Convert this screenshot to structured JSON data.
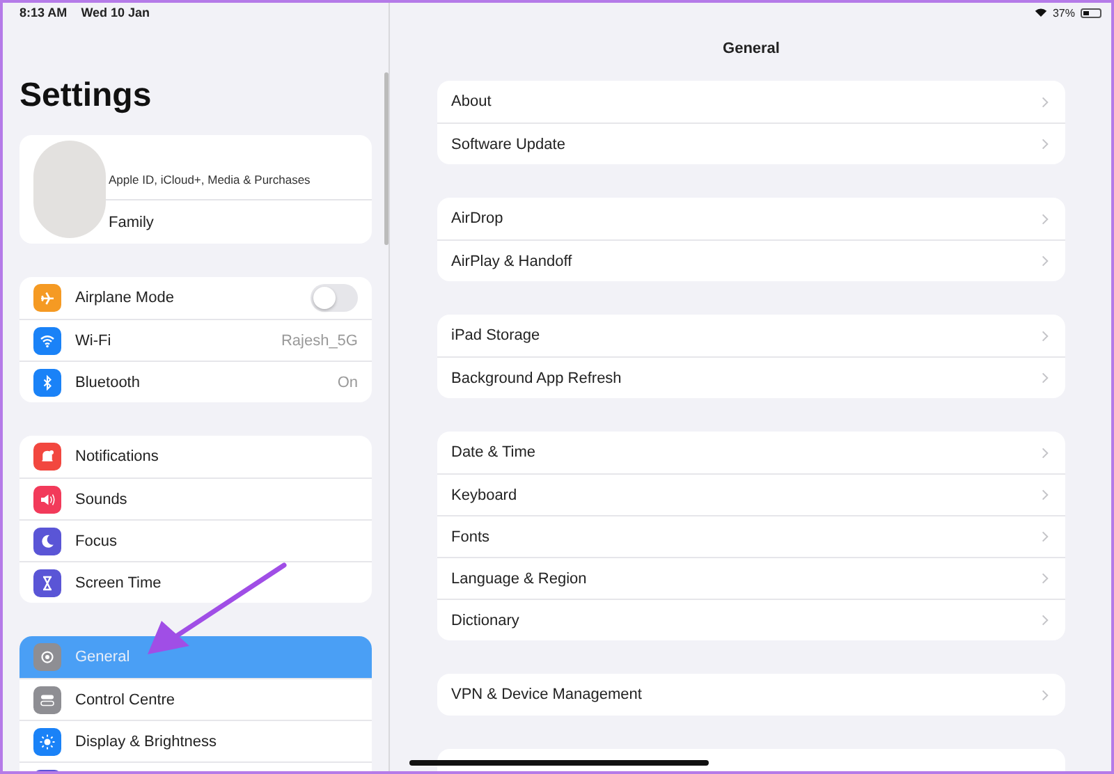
{
  "status_bar": {
    "time": "8:13 AM",
    "date": "Wed 10 Jan",
    "battery": "37%"
  },
  "sidebar": {
    "title": "Settings",
    "account": {
      "subtitle": "Apple ID, iCloud+, Media & Purchases",
      "family": "Family"
    },
    "groups": [
      {
        "items": [
          {
            "label": "Airplane Mode",
            "kind": "toggle",
            "on": false,
            "color": "#f59a23",
            "selected": false
          },
          {
            "label": "Wi-Fi",
            "kind": "value",
            "value": "Rajesh_5G",
            "color": "#1a82f7",
            "selected": false
          },
          {
            "label": "Bluetooth",
            "kind": "value",
            "value": "On",
            "color": "#1a82f7",
            "selected": false
          }
        ]
      },
      {
        "items": [
          {
            "label": "Notifications",
            "kind": "link",
            "color": "#f2473f",
            "selected": false
          },
          {
            "label": "Sounds",
            "kind": "link",
            "color": "#f23a5a",
            "selected": false
          },
          {
            "label": "Focus",
            "kind": "link",
            "color": "#5a55d6",
            "selected": false
          },
          {
            "label": "Screen Time",
            "kind": "link",
            "color": "#5a55d6",
            "selected": false
          }
        ]
      },
      {
        "items": [
          {
            "label": "General",
            "kind": "link",
            "color": "#8e8e93",
            "selected": true
          },
          {
            "label": "Control Centre",
            "kind": "link",
            "color": "#8e8e93",
            "selected": false
          },
          {
            "label": "Display & Brightness",
            "kind": "link",
            "color": "#1a82f7",
            "selected": false
          },
          {
            "kind": "link",
            "color": "#5a55d6",
            "selected": false
          }
        ]
      }
    ]
  },
  "detail": {
    "title": "General",
    "groups": [
      {
        "items": [
          "About",
          "Software Update"
        ]
      },
      {
        "items": [
          "AirDrop",
          "AirPlay & Handoff"
        ]
      },
      {
        "items": [
          "iPad Storage",
          "Background App Refresh"
        ]
      },
      {
        "items": [
          "Date & Time",
          "Keyboard",
          "Fonts",
          "Language & Region",
          "Dictionary"
        ]
      },
      {
        "items": [
          "VPN & Device Management"
        ]
      }
    ]
  }
}
